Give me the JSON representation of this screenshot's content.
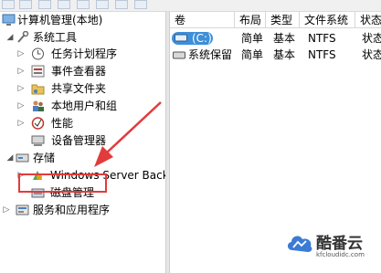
{
  "tree": {
    "root": "计算机管理(本地)",
    "system_tools": "系统工具",
    "task_scheduler": "任务计划程序",
    "event_viewer": "事件查看器",
    "shared_folders": "共享文件夹",
    "local_users": "本地用户和组",
    "performance": "性能",
    "device_manager": "设备管理器",
    "storage": "存储",
    "windows_server_backup": "Windows Server Back",
    "disk_management": "磁盘管理",
    "services_apps": "服务和应用程序"
  },
  "columns": [
    "卷",
    "布局",
    "类型",
    "文件系统",
    "状态"
  ],
  "rows": [
    {
      "volume": "(C:)",
      "layout": "简单",
      "type": "基本",
      "fs": "NTFS",
      "status": "状态"
    },
    {
      "volume": "系统保留",
      "layout": "简单",
      "type": "基本",
      "fs": "NTFS",
      "status": "状态"
    }
  ],
  "watermark": {
    "name": "酷番云",
    "domain": "kfcloudidc.com"
  },
  "colors": {
    "annotation": "#e23b3b",
    "selection": "#3d8fd8",
    "brand": "#3b7bd5"
  }
}
